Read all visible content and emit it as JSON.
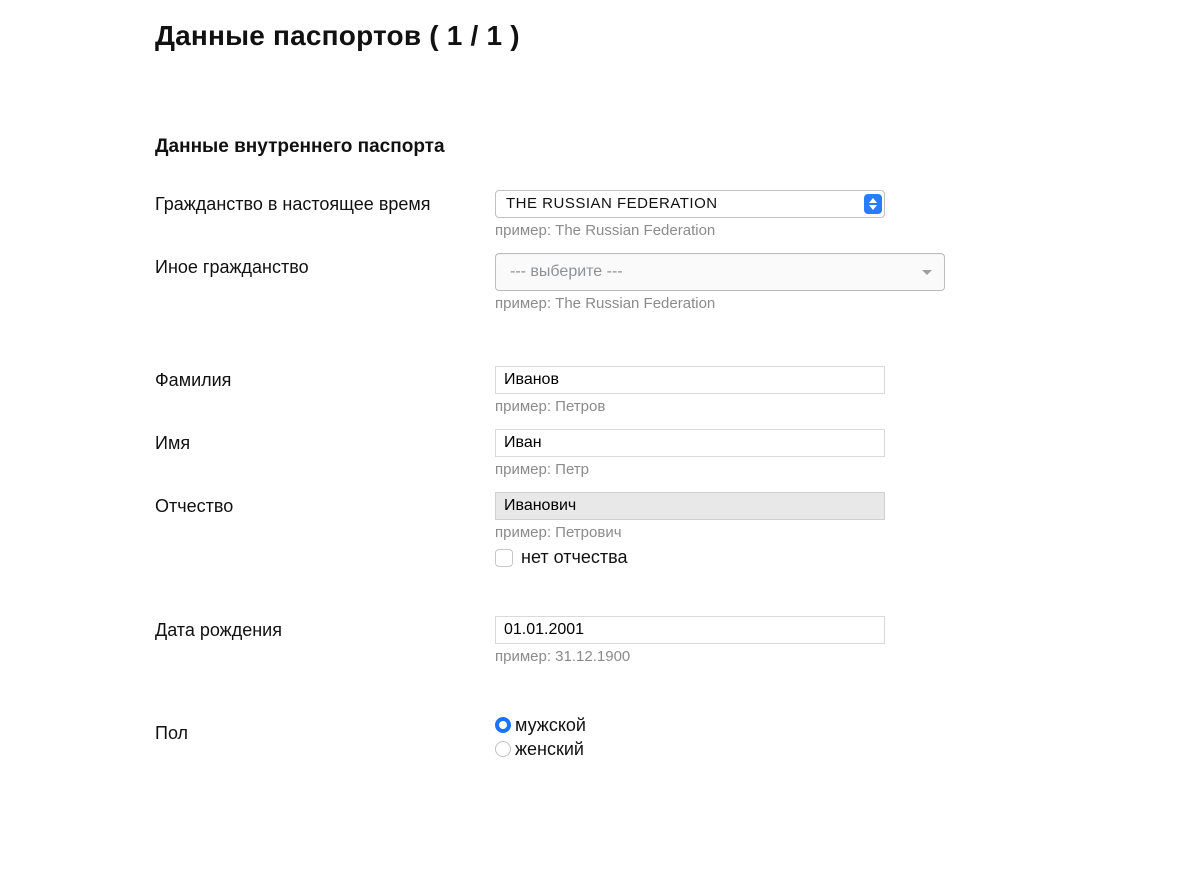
{
  "page_title": "Данные паспортов ( 1 / 1 )",
  "section_title": "Данные внутреннего паспорта",
  "fields": {
    "citizenship": {
      "label": "Гражданство в настоящее время",
      "value": "THE RUSSIAN FEDERATION",
      "hint": "пример: The Russian Federation"
    },
    "other_citizenship": {
      "label": "Иное гражданство",
      "placeholder": "--- выберите ---",
      "hint": "пример: The Russian Federation"
    },
    "surname": {
      "label": "Фамилия",
      "value": "Иванов",
      "hint": "пример: Петров"
    },
    "given_name": {
      "label": "Имя",
      "value": "Иван",
      "hint": "пример: Петр"
    },
    "patronymic": {
      "label": "Отчество",
      "value": "Иванович",
      "hint": "пример: Петрович",
      "no_patronymic_label": "нет отчества"
    },
    "dob": {
      "label": "Дата рождения",
      "value": "01.01.2001",
      "hint": "пример: 31.12.1900"
    },
    "sex": {
      "label": "Пол",
      "options": {
        "male": "мужской",
        "female": "женский"
      },
      "selected": "male"
    }
  }
}
